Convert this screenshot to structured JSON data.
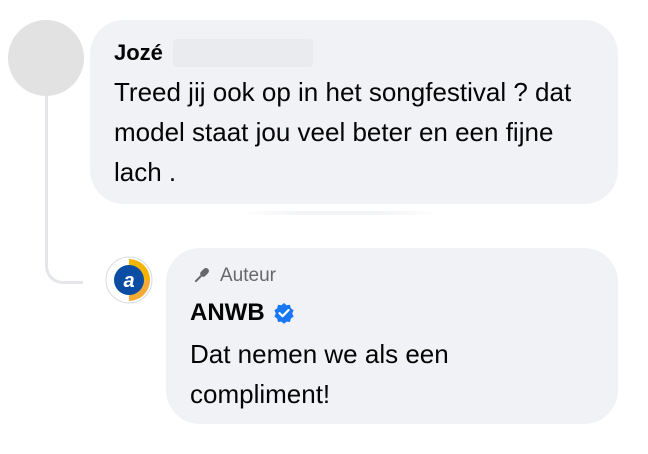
{
  "comment": {
    "author": "Jozé",
    "text": "Treed jij ook op in het songfestival ? dat model staat jou veel beter en een fijne lach ."
  },
  "reply": {
    "badge_icon": "microphone-icon",
    "badge_label": "Auteur",
    "author": "ANWB",
    "verified_icon": "verified-badge-icon",
    "verified_color": "#1877f2",
    "text": "Dat nemen we als een compliment!"
  },
  "colors": {
    "bubble_bg": "#f0f2f5",
    "text": "#050505",
    "muted": "#65676b"
  }
}
